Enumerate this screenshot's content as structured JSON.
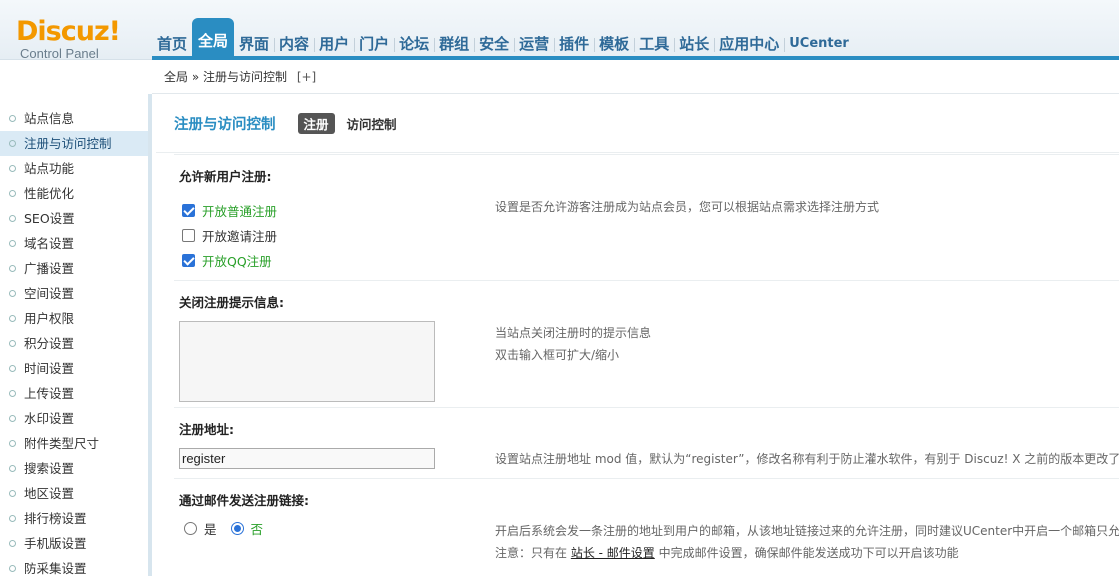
{
  "logo": {
    "main": "Discuz!",
    "sub": "Control Panel"
  },
  "nav": {
    "items": [
      "首页",
      "全局",
      "界面",
      "内容",
      "用户",
      "门户",
      "论坛",
      "群组",
      "安全",
      "运营",
      "插件",
      "模板",
      "工具",
      "站长",
      "应用中心",
      "UCenter"
    ],
    "active": "全局"
  },
  "breadcrumb": {
    "text": "全局 » 注册与访问控制",
    "plus": "[+]"
  },
  "sidebar": {
    "items": [
      "站点信息",
      "注册与访问控制",
      "站点功能",
      "性能优化",
      "SEO设置",
      "域名设置",
      "广播设置",
      "空间设置",
      "用户权限",
      "积分设置",
      "时间设置",
      "上传设置",
      "水印设置",
      "附件类型尺寸",
      "搜索设置",
      "地区设置",
      "排行榜设置",
      "手机版设置",
      "防采集设置"
    ],
    "active": "注册与访问控制"
  },
  "page": {
    "title": "注册与访问控制",
    "tabs": {
      "register": "注册",
      "access": "访问控制"
    }
  },
  "form": {
    "allow_register": {
      "label": "允许新用户注册:",
      "options": [
        {
          "label": "开放普通注册",
          "checked": true
        },
        {
          "label": "开放邀请注册",
          "checked": false
        },
        {
          "label": "开放QQ注册",
          "checked": true
        }
      ],
      "hint": "设置是否允许游客注册成为站点会员，您可以根据站点需求选择注册方式"
    },
    "close_message": {
      "label": "关闭注册提示信息:",
      "value": "",
      "hint1": "当站点关闭注册时的提示信息",
      "hint2": "双击输入框可扩大/缩小"
    },
    "register_url": {
      "label": "注册地址:",
      "value": "register",
      "hint": "设置站点注册地址 mod 值，默认为“register”，修改名称有利于防止灌水软件，有别于 Discuz! X 之前的版本更改了"
    },
    "email_link": {
      "label": "通过邮件发送注册链接:",
      "yes": "是",
      "no": "否",
      "selected": "no",
      "hint1": "开启后系统会发一条注册的地址到用户的邮箱，从该地址链接过来的允许注册，同时建议UCenter中开启一个邮箱只允",
      "hint2_pre": "注意：只有在 ",
      "hint2_link": "站长 - 邮件设置",
      "hint2_post": " 中完成邮件设置，确保邮件能发送成功下可以开启该功能"
    }
  }
}
